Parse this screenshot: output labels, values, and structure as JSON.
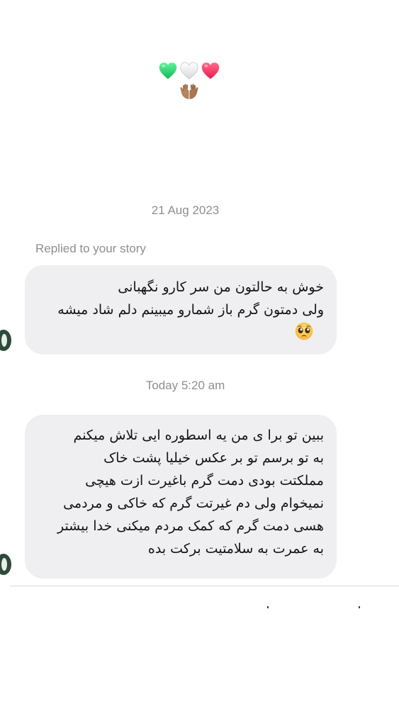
{
  "top_reaction": {
    "emojis": [
      "green-heart",
      "white-heart",
      "red-heart",
      "palms-up-together"
    ]
  },
  "thread": {
    "timestamp_1": "21 Aug 2023",
    "reply_note": "Replied to your story",
    "message_1": {
      "text": "خوش به حالتون من سر کارو نگهبانی\nولی دمتون گرم باز شمارو میبینم دلم شاد میشه",
      "emoji": "pleading-face"
    },
    "timestamp_2": "Today 5:20 am",
    "message_2": {
      "text": "ببین تو برا ی من یه اسطوره ایی تلاش میکنم\nبه تو برسم تو بر عکس خیلیا پشت خاک\nمملکتت بودی دمت گرم باغیرت ازت هیچی\nنمیخوام ولی دم غیرتت گرم که خاکی و مردمی\nهسی دمت گرم که کمک مردم میکنی خدا بیشتر\nبه عمرت به سلامتیت برکت بده"
    }
  },
  "colors": {
    "bubble_bg": "#efeef1",
    "meta_text": "#8e8e93",
    "green_heart": "#22c55e",
    "red_heart": "#f43f6a"
  }
}
